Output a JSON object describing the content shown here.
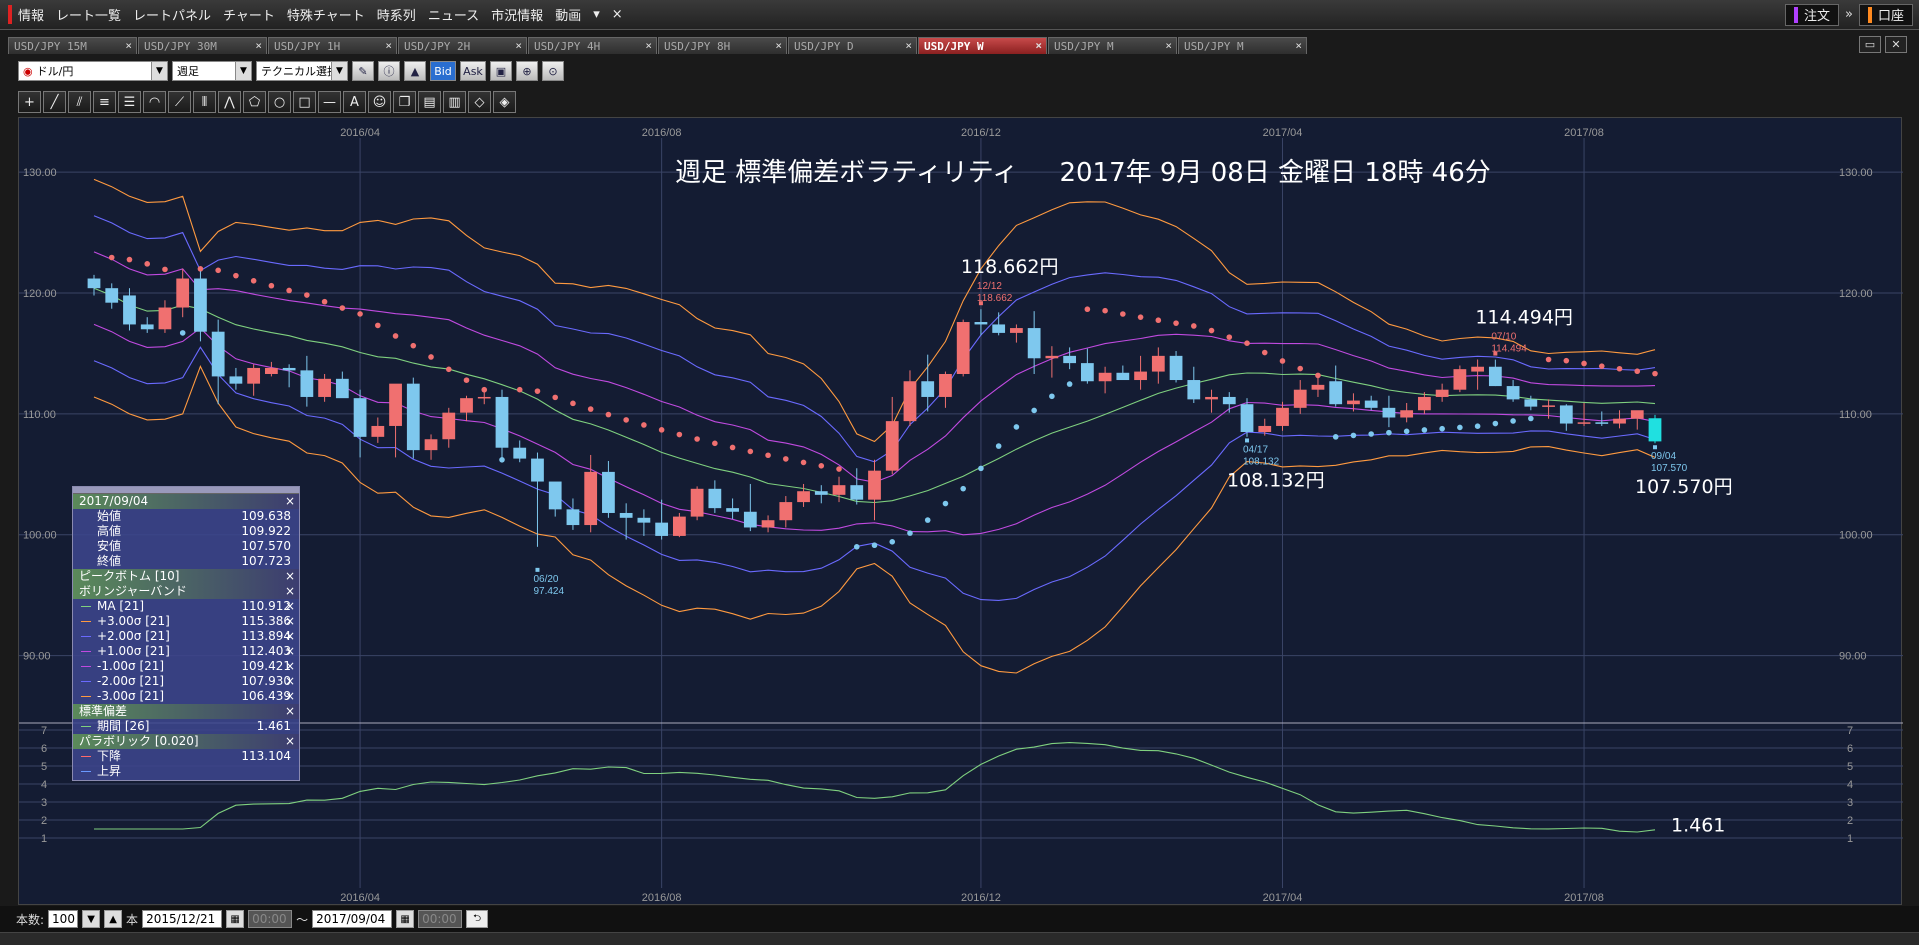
{
  "menubar": {
    "items": [
      "情報",
      "レート一覧",
      "レートパネル",
      "チャート",
      "特殊チャート",
      "時系列",
      "ニュース",
      "市況情報",
      "動画"
    ],
    "more": "▾",
    "close": "×",
    "order_label": "注文",
    "account_label": "口座",
    "expand": "»"
  },
  "tabs": [
    {
      "label": "USD/JPY 15M",
      "active": false
    },
    {
      "label": "USD/JPY 30M",
      "active": false
    },
    {
      "label": "USD/JPY 1H",
      "active": false
    },
    {
      "label": "USD/JPY 2H",
      "active": false
    },
    {
      "label": "USD/JPY 4H",
      "active": false
    },
    {
      "label": "USD/JPY 8H",
      "active": false
    },
    {
      "label": "USD/JPY D",
      "active": false
    },
    {
      "label": "USD/JPY W",
      "active": true
    },
    {
      "label": "USD/JPY M",
      "active": false
    },
    {
      "label": "USD/JPY M",
      "active": false
    }
  ],
  "toolbar": {
    "pair": "ドル/円",
    "period": "週足",
    "technical": "テクニカル選択",
    "bid": "Bid",
    "ask": "Ask"
  },
  "chart_data": {
    "type": "candlestick",
    "title": "週足 標準偏差ボラティリティ     2017年 9月 08日 金曜日 18時 46分",
    "x_ticks": [
      "2016/04",
      "2016/08",
      "2016/12",
      "2017/04",
      "2017/08"
    ],
    "y_ticks_main": [
      "130.00",
      "120.00",
      "110.00",
      "100.00",
      "90.00"
    ],
    "y_ticks_sub": [
      "1",
      "2",
      "3",
      "4",
      "5",
      "6",
      "7"
    ],
    "ylim_main": [
      85,
      132
    ],
    "ylim_sub": [
      1,
      7
    ],
    "candles": [
      [
        121.2,
        121.5,
        119.8,
        120.4
      ],
      [
        120.4,
        120.8,
        118.7,
        119.2
      ],
      [
        119.8,
        120.4,
        116.9,
        117.4
      ],
      [
        117.4,
        118.0,
        116.7,
        117.0
      ],
      [
        117.0,
        119.4,
        116.7,
        118.8
      ],
      [
        118.8,
        122.0,
        118.0,
        121.2
      ],
      [
        121.2,
        121.8,
        116.0,
        116.8
      ],
      [
        116.8,
        117.8,
        110.8,
        113.1
      ],
      [
        113.1,
        113.8,
        112.0,
        112.5
      ],
      [
        112.5,
        114.1,
        111.5,
        113.8
      ],
      [
        113.3,
        114.3,
        113.1,
        113.8
      ],
      [
        113.8,
        114.1,
        112.2,
        113.6
      ],
      [
        113.6,
        114.8,
        110.6,
        111.4
      ],
      [
        111.4,
        113.3,
        111.0,
        112.9
      ],
      [
        112.9,
        113.5,
        111.5,
        111.3
      ],
      [
        111.3,
        112.0,
        106.4,
        108.1
      ],
      [
        108.1,
        109.7,
        107.6,
        109.0
      ],
      [
        109.0,
        111.9,
        106.4,
        112.5
      ],
      [
        112.5,
        113.0,
        106.3,
        107.0
      ],
      [
        107.0,
        108.3,
        106.2,
        107.9
      ],
      [
        107.9,
        110.5,
        107.2,
        110.1
      ],
      [
        110.1,
        111.5,
        109.4,
        111.3
      ],
      [
        111.3,
        111.9,
        110.8,
        111.4
      ],
      [
        111.4,
        112.0,
        106.2,
        107.2
      ],
      [
        107.2,
        107.8,
        106.0,
        106.3
      ],
      [
        106.3,
        106.8,
        99.0,
        104.4
      ],
      [
        104.4,
        103.1,
        101.5,
        102.1
      ],
      [
        102.1,
        103.0,
        100.4,
        100.8
      ],
      [
        100.8,
        106.6,
        100.2,
        105.2
      ],
      [
        105.2,
        106.1,
        101.4,
        101.8
      ],
      [
        101.8,
        102.6,
        99.6,
        101.4
      ],
      [
        101.4,
        102.1,
        99.9,
        101.0
      ],
      [
        101.0,
        102.9,
        99.6,
        99.9
      ],
      [
        99.9,
        101.8,
        99.8,
        101.5
      ],
      [
        101.5,
        104.0,
        101.2,
        103.8
      ],
      [
        103.8,
        104.5,
        101.8,
        102.2
      ],
      [
        102.2,
        103.0,
        101.3,
        101.9
      ],
      [
        101.9,
        104.2,
        100.3,
        100.6
      ],
      [
        100.6,
        101.6,
        100.2,
        101.2
      ],
      [
        101.2,
        103.2,
        100.6,
        102.7
      ],
      [
        102.7,
        104.2,
        102.3,
        103.6
      ],
      [
        103.6,
        104.1,
        102.6,
        103.3
      ],
      [
        103.3,
        104.8,
        102.7,
        104.1
      ],
      [
        104.1,
        105.5,
        102.5,
        102.9
      ],
      [
        102.9,
        106.2,
        101.2,
        105.3
      ],
      [
        105.3,
        111.4,
        105.0,
        109.4
      ],
      [
        109.4,
        113.6,
        109.0,
        112.7
      ],
      [
        112.7,
        114.9,
        110.2,
        111.4
      ],
      [
        111.4,
        113.5,
        110.5,
        113.3
      ],
      [
        113.3,
        117.8,
        113.1,
        117.6
      ],
      [
        117.6,
        118.66,
        116.5,
        117.4
      ],
      [
        117.4,
        118.4,
        116.5,
        116.7
      ],
      [
        116.7,
        117.4,
        115.9,
        117.1
      ],
      [
        117.1,
        118.5,
        113.3,
        114.6
      ],
      [
        114.6,
        115.6,
        113.0,
        114.8
      ],
      [
        114.8,
        115.5,
        113.7,
        114.2
      ],
      [
        114.2,
        115.4,
        112.5,
        112.7
      ],
      [
        112.7,
        113.9,
        111.7,
        113.4
      ],
      [
        113.4,
        114.0,
        112.9,
        112.8
      ],
      [
        112.8,
        114.8,
        112.0,
        113.5
      ],
      [
        113.5,
        115.5,
        112.5,
        114.8
      ],
      [
        114.8,
        115.2,
        112.6,
        112.8
      ],
      [
        112.8,
        113.9,
        110.9,
        111.2
      ],
      [
        111.2,
        112.0,
        110.1,
        111.4
      ],
      [
        111.4,
        111.8,
        110.1,
        110.8
      ],
      [
        110.8,
        111.3,
        108.1,
        108.5
      ],
      [
        108.5,
        109.6,
        108.2,
        109.0
      ],
      [
        109.0,
        111.0,
        108.6,
        110.5
      ],
      [
        110.5,
        112.8,
        110.0,
        112.0
      ],
      [
        112.0,
        113.0,
        111.4,
        112.4
      ],
      [
        112.7,
        114.0,
        110.6,
        110.8
      ],
      [
        110.8,
        111.7,
        110.2,
        111.1
      ],
      [
        111.1,
        111.5,
        110.3,
        110.5
      ],
      [
        110.5,
        111.5,
        108.9,
        109.7
      ],
      [
        109.7,
        110.9,
        109.3,
        110.3
      ],
      [
        110.3,
        111.8,
        110.0,
        111.4
      ],
      [
        111.4,
        112.5,
        111.0,
        112.0
      ],
      [
        112.0,
        114.0,
        111.8,
        113.7
      ],
      [
        113.5,
        114.5,
        112.0,
        113.9
      ],
      [
        113.9,
        114.49,
        112.3,
        112.3
      ],
      [
        112.3,
        112.8,
        111.0,
        111.2
      ],
      [
        111.2,
        111.5,
        110.3,
        110.6
      ],
      [
        110.6,
        111.2,
        109.6,
        110.7
      ],
      [
        110.7,
        110.8,
        108.6,
        109.2
      ],
      [
        109.2,
        110.9,
        109.0,
        109.3
      ],
      [
        109.3,
        110.2,
        109.0,
        109.2
      ],
      [
        109.2,
        110.3,
        108.8,
        109.6
      ],
      [
        109.6,
        110.1,
        108.7,
        110.3
      ],
      [
        109.638,
        109.922,
        107.57,
        107.723
      ]
    ],
    "annotations": [
      {
        "label": "118.662円",
        "date": "12/12",
        "value": "118.662",
        "kind": "high"
      },
      {
        "label": "114.494円",
        "date": "07/10",
        "value": "114.494",
        "kind": "high"
      },
      {
        "label": "108.132円",
        "date": "04/17",
        "value": "108.132",
        "kind": "low"
      },
      {
        "label": "107.570円",
        "date": "09/04",
        "value": "107.570",
        "kind": "low"
      },
      {
        "label": "",
        "date": "06/20",
        "value": "97.424",
        "kind": "low"
      }
    ],
    "stddev_last_label": "1.461"
  },
  "legend": {
    "date": "2017/09/04",
    "ohlc": [
      {
        "label": "始値",
        "value": "109.638"
      },
      {
        "label": "高値",
        "value": "109.922"
      },
      {
        "label": "安値",
        "value": "107.570"
      },
      {
        "label": "終値",
        "value": "107.723"
      }
    ],
    "peak_bottom": "ピークボトム [10]",
    "bollinger": "ボリンジャーバンド",
    "bands": [
      {
        "label": "MA [21]",
        "value": "110.912",
        "color": "#7fd07f"
      },
      {
        "label": "+3.00σ [21]",
        "value": "115.386",
        "color": "#ff9a40"
      },
      {
        "label": "+2.00σ [21]",
        "value": "113.894",
        "color": "#6a6aff"
      },
      {
        "label": "+1.00σ [21]",
        "value": "112.403",
        "color": "#c04ae0"
      },
      {
        "label": "-1.00σ [21]",
        "value": "109.421",
        "color": "#c04ae0"
      },
      {
        "label": "-2.00σ [21]",
        "value": "107.930",
        "color": "#6a6aff"
      },
      {
        "label": "-3.00σ [21]",
        "value": "106.439",
        "color": "#ff9a40"
      }
    ],
    "stddev": "標準偏差",
    "stddev_row": {
      "label": "期間 [26]",
      "value": "1.461",
      "color": "#7fd07f"
    },
    "parabolic": "パラボリック [0.020]",
    "sar_down": {
      "label": "下降",
      "value": "113.104",
      "color": "#ff6a6a"
    },
    "sar_up": {
      "label": "上昇",
      "value": "",
      "color": "#6a9aff"
    }
  },
  "status": {
    "count_label": "本数:",
    "count_value": "100",
    "unit": "本",
    "from_date": "2015/12/21",
    "from_time": "00:00",
    "tilde": "〜",
    "to_date": "2017/09/04",
    "to_time": "00:00"
  },
  "colors": {
    "bull": "#f07070",
    "bear": "#7ec8ee",
    "last": "#20e0e0",
    "background": "#141c33"
  }
}
